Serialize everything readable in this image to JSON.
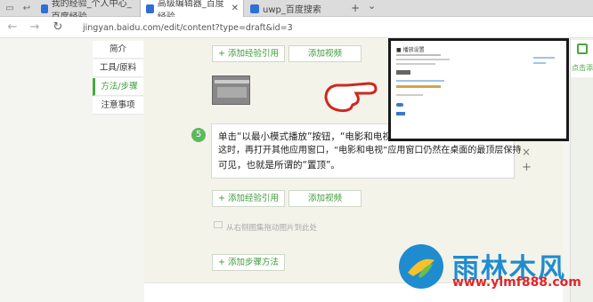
{
  "browser": {
    "tabs": [
      {
        "label": "我的经验_个人中心_百度经验",
        "active": false
      },
      {
        "label": "高级编辑器_百度经验",
        "active": true
      },
      {
        "label": "uwp_百度搜索",
        "active": false
      }
    ],
    "new_tab_label": "+",
    "tab_menu_label": "⌄",
    "url": "jingyan.baidu.com/edit/content?type=draft&id=3"
  },
  "left_nav": {
    "items": [
      {
        "label": "简介",
        "selected": false
      },
      {
        "label": "工具/原料",
        "selected": false
      },
      {
        "label": "方法/步骤",
        "selected": true
      },
      {
        "label": "注意事项",
        "selected": false
      }
    ]
  },
  "editor": {
    "add_experience_ref": "+ 添加经验引用",
    "add_video": "添加视频",
    "step_number": "5",
    "step_text": "单击“以最小模式播放”按钮，“电影和电视”这时，再打开其他应用窗口，“电影和电视”应用窗口仍然在桌面的最顶层保持可见，也就是所谓的“置顶”。",
    "step_text_lines": [
      "单击“以最小模式播放”按钮，“电影和电视”",
      "这时，再打开其他应用窗口，“电影和电视”应用窗口仍然在桌面的最顶层保持",
      "可见，也就是所谓的“置顶”。"
    ],
    "add_experience_ref_2": "+ 添加经验引用",
    "add_video_2": "添加视频",
    "upload_hint": "从右侧图集拖动图片到此处",
    "add_step": "+ 添加步骤方法",
    "close_glyph": "×",
    "plus_glyph": "+"
  },
  "popup": {
    "title": "■ 播放设置"
  },
  "right_rail": {
    "label": "点击添"
  },
  "watermark": {
    "brand": "雨林木风",
    "url": "www.ylmf888.com"
  },
  "colors": {
    "accent_green": "#4aa83f",
    "watermark_blue": "#1f8ccf",
    "watermark_red": "#e0262b"
  }
}
